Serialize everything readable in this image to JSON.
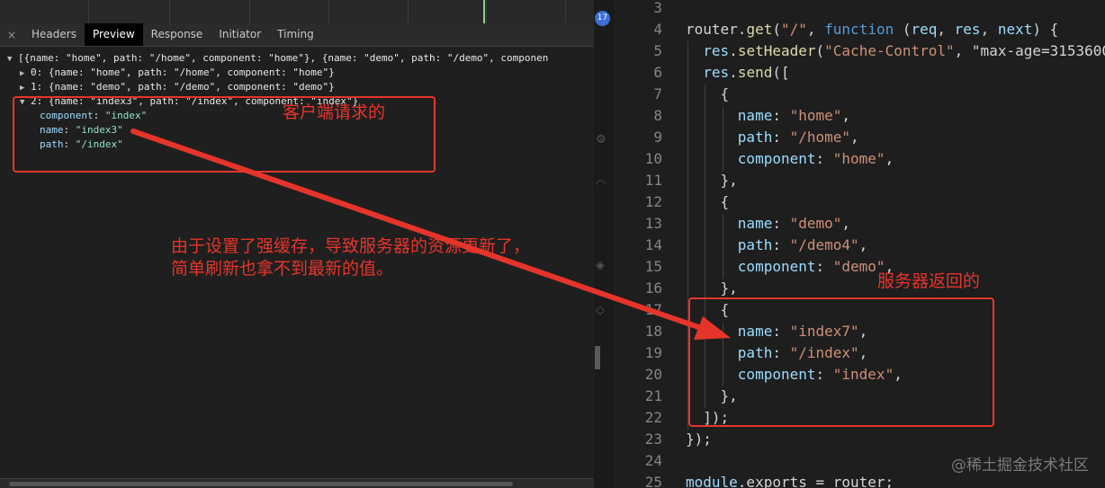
{
  "devtools": {
    "tabs": [
      "Headers",
      "Preview",
      "Response",
      "Initiator",
      "Timing"
    ],
    "active_tab": "Preview",
    "close_glyph": "×",
    "preview": {
      "root_line": "[{name: \"home\", path: \"/home\", component: \"home\"}, {name: \"demo\", path: \"/demo\", componen",
      "items": [
        {
          "line": "0: {name: \"home\", path: \"/home\", component: \"home\"}",
          "expanded": false
        },
        {
          "line": "1: {name: \"demo\", path: \"/demo\", component: \"demo\"}",
          "expanded": false
        },
        {
          "line": "2: {name: \"index3\", path: \"/index\", component: \"index\"}",
          "expanded": true
        }
      ],
      "expanded_props": [
        {
          "key": "component",
          "value": "\"index\""
        },
        {
          "key": "name",
          "value": "\"index3\""
        },
        {
          "key": "path",
          "value": "\"/index\""
        }
      ]
    },
    "badge": "17"
  },
  "editor": {
    "lines": [
      {
        "n": "3",
        "text": ""
      },
      {
        "n": "4",
        "text": "router.get(\"/\", function (req, res, next) {"
      },
      {
        "n": "5",
        "text": "  res.setHeader(\"Cache-Control\", \"max-age=3153600"
      },
      {
        "n": "6",
        "text": "  res.send(["
      },
      {
        "n": "7",
        "text": "    {"
      },
      {
        "n": "8",
        "text": "      name: \"home\","
      },
      {
        "n": "9",
        "text": "      path: \"/home\","
      },
      {
        "n": "10",
        "text": "      component: \"home\","
      },
      {
        "n": "11",
        "text": "    },"
      },
      {
        "n": "12",
        "text": "    {"
      },
      {
        "n": "13",
        "text": "      name: \"demo\","
      },
      {
        "n": "14",
        "text": "      path: \"/demo4\","
      },
      {
        "n": "15",
        "text": "      component: \"demo\","
      },
      {
        "n": "16",
        "text": "    },"
      },
      {
        "n": "17",
        "text": "    {"
      },
      {
        "n": "18",
        "text": "      name: \"index7\","
      },
      {
        "n": "19",
        "text": "      path: \"/index\","
      },
      {
        "n": "20",
        "text": "      component: \"index\","
      },
      {
        "n": "21",
        "text": "    },"
      },
      {
        "n": "22",
        "text": "  ]);"
      },
      {
        "n": "23",
        "text": "});"
      },
      {
        "n": "24",
        "text": ""
      },
      {
        "n": "25",
        "text": "module.exports = router;"
      }
    ]
  },
  "annotations": {
    "client_label": "客户端请求的",
    "server_label": "服务器返回的",
    "explanation_line1": "由于设置了强缓存，导致服务器的资源更新了，",
    "explanation_line2": "简单刷新也拿不到最新的值。",
    "color": "#e5352b"
  },
  "watermark": "@稀土掘金技术社区"
}
